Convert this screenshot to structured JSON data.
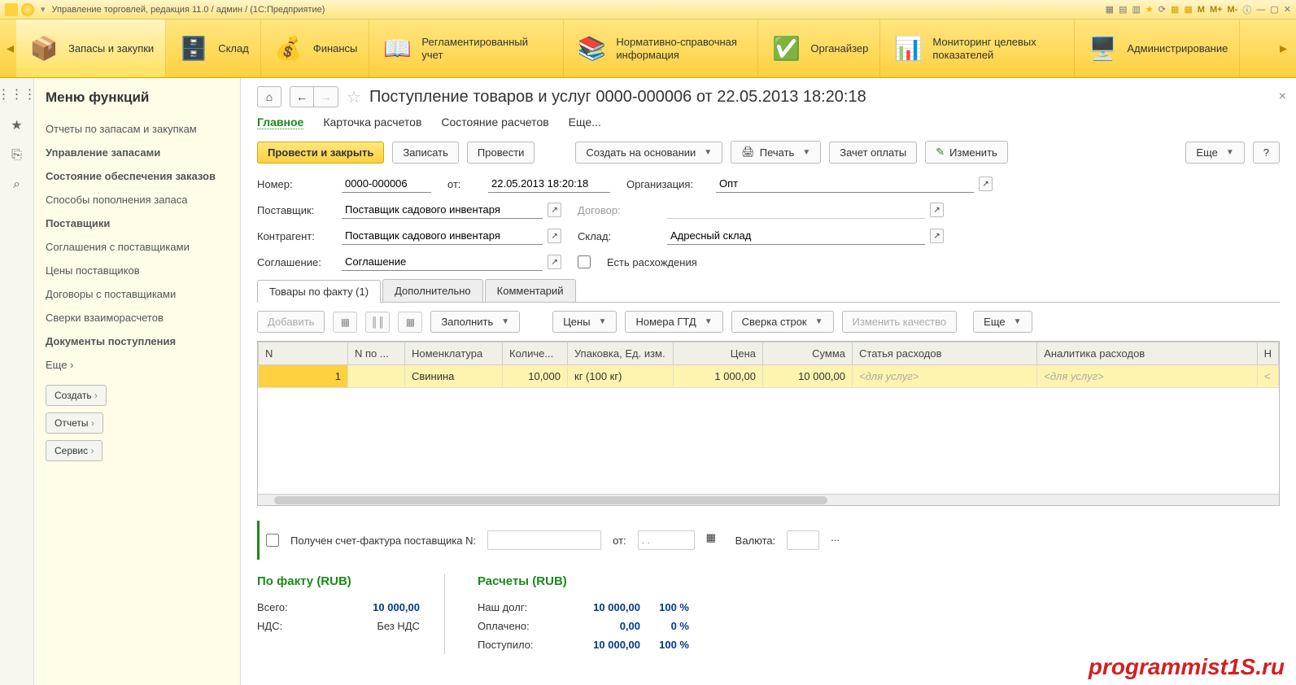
{
  "titlebar": {
    "text": "Управление торговлей, редакция 11.0 / админ /   (1С:Предприятие)",
    "icons": {
      "m": "M",
      "mplus": "M+",
      "mminus": "M-"
    }
  },
  "ribbon": {
    "sections": [
      {
        "label": "Запасы и закупки",
        "icon": "📦"
      },
      {
        "label": "Склад",
        "icon": "🗄️"
      },
      {
        "label": "Финансы",
        "icon": "💰"
      },
      {
        "label": "Регламентированный учет",
        "icon": "📖"
      },
      {
        "label": "Нормативно-справочная информация",
        "icon": "📚"
      },
      {
        "label": "Органайзер",
        "icon": "✅"
      },
      {
        "label": "Мониторинг целевых показателей",
        "icon": "📊"
      },
      {
        "label": "Администрирование",
        "icon": "🖥️"
      }
    ]
  },
  "sidebar": {
    "title": "Меню функций",
    "items": [
      {
        "label": "Отчеты по запасам и закупкам",
        "bold": false
      },
      {
        "label": "Управление запасами",
        "bold": true
      },
      {
        "label": "Состояние обеспечения заказов",
        "bold": true
      },
      {
        "label": "Способы пополнения запаса",
        "bold": false
      },
      {
        "label": "Поставщики",
        "bold": true
      },
      {
        "label": "Соглашения с поставщиками",
        "bold": false
      },
      {
        "label": "Цены поставщиков",
        "bold": false
      },
      {
        "label": "Договоры с поставщиками",
        "bold": false
      },
      {
        "label": "Сверки взаиморасчетов",
        "bold": false
      },
      {
        "label": "Документы поступления",
        "bold": true
      },
      {
        "label": "Еще ›",
        "bold": false
      }
    ],
    "buttons": {
      "create": "Создать",
      "reports": "Отчеты",
      "service": "Сервис"
    }
  },
  "doc": {
    "title": "Поступление товаров и услуг 0000-000006 от 22.05.2013 18:20:18",
    "form_tabs": {
      "main": "Главное",
      "card": "Карточка расчетов",
      "state": "Состояние расчетов",
      "more": "Еще..."
    },
    "toolbar": {
      "post_close": "Провести и закрыть",
      "write": "Записать",
      "post": "Провести",
      "create_based": "Создать на основании",
      "print": "Печать",
      "offset": "Зачет оплаты",
      "edit": "Изменить",
      "more": "Еще"
    },
    "fields": {
      "number_l": "Номер:",
      "number_v": "0000-000006",
      "from_l": "от:",
      "from_v": "22.05.2013 18:20:18",
      "org_l": "Организация:",
      "org_v": "Опт",
      "supplier_l": "Поставщик:",
      "supplier_v": "Поставщик садового инвентаря",
      "contract_l": "Договор:",
      "contract_v": "",
      "counter_l": "Контрагент:",
      "counter_v": "Поставщик садового инвентаря",
      "warehouse_l": "Склад:",
      "warehouse_v": "Адресный склад",
      "agreement_l": "Соглашение:",
      "agreement_v": "Соглашение",
      "discrep_l": "Есть расхождения"
    },
    "tabs2": {
      "goods": "Товары по факту (1)",
      "extra": "Дополнительно",
      "comment": "Комментарий"
    },
    "grid_toolbar": {
      "add": "Добавить",
      "fill": "Заполнить",
      "prices": "Цены",
      "gtd": "Номера ГТД",
      "reconcile": "Сверка строк",
      "quality": "Изменить качество",
      "more": "Еще"
    },
    "grid": {
      "cols": {
        "n": "N",
        "npo": "N по ...",
        "nomen": "Номенклатура",
        "qty": "Количе...",
        "pack": "Упаковка, Ед. изм.",
        "price": "Цена",
        "sum": "Сумма",
        "exp": "Статья расходов",
        "anal": "Аналитика расходов",
        "h": "Н"
      },
      "row": {
        "n": "1",
        "npo": "",
        "nomen": "Свинина",
        "qty": "10,000",
        "pack": "кг (100 кг)",
        "price": "1 000,00",
        "sum": "10 000,00",
        "exp": "<для услуг>",
        "anal": "<для услуг>",
        "h": "<"
      }
    },
    "invoice": {
      "chk_l": "Получен счет-фактура поставщика N:",
      "from_l": "от:",
      "from_ph": ". .",
      "currency_l": "Валюта:",
      "currency_ph": "..."
    },
    "totals": {
      "fact_h": "По факту (RUB)",
      "calc_h": "Расчеты (RUB)",
      "total_l": "Всего:",
      "total_v": "10 000,00",
      "vat_l": "НДС:",
      "vat_v": "Без НДС",
      "debt_l": "Наш долг:",
      "debt_v": "10 000,00",
      "debt_p": "100 %",
      "paid_l": "Оплачено:",
      "paid_v": "0,00",
      "paid_p": "0 %",
      "recv_l": "Поступило:",
      "recv_v": "10 000,00",
      "recv_p": "100 %"
    }
  },
  "watermark": "programmist1S.ru"
}
